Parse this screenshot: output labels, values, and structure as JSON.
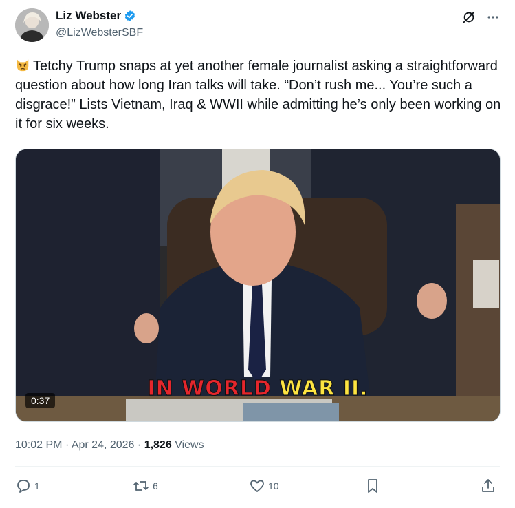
{
  "author": {
    "name": "Liz Webster",
    "handle": "@LizWebsterSBF",
    "verified": true
  },
  "tweet": {
    "emoji": "angry-cat-emoji",
    "text": "Tetchy Trump snaps at yet another female journalist asking a straightforward question about how long Iran talks will take. “Don’t rush me... You’re such a disgrace!” Lists Vietnam, Iraq & WWII while admitting he’s only been working on it for six weeks."
  },
  "video": {
    "caption_part1": "IN WORLD ",
    "caption_part2": "WAR II.",
    "duration": "0:37"
  },
  "meta": {
    "time": "10:02 PM",
    "separator": "·",
    "date": "Apr 24, 2026",
    "views_count": "1,826",
    "views_label": "Views"
  },
  "actions": {
    "replies": "1",
    "reposts": "6",
    "likes": "10"
  },
  "colors": {
    "verified": "#1d9bf0",
    "icon_gray": "#536471",
    "caption_red": "#e5262c",
    "caption_yellow": "#fde441"
  }
}
